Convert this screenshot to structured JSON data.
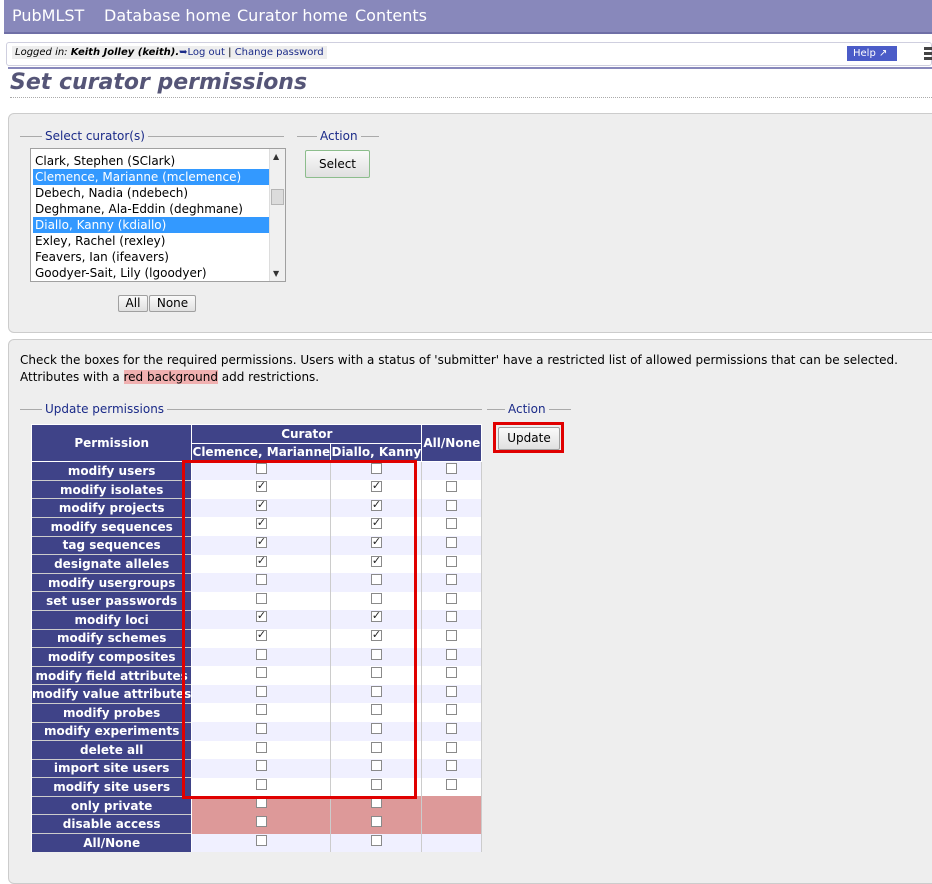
{
  "nav": {
    "items": [
      "PubMLST",
      "Database home",
      "Curator home",
      "Contents"
    ]
  },
  "login": {
    "prefix": "Logged in:",
    "user": "Keith Jolley (keith).",
    "logout": "Log out",
    "separator": "|",
    "change_password": "Change password"
  },
  "help": {
    "label": "Help",
    "icon": "external-link-icon"
  },
  "page_title": "Set curator permissions",
  "select_panel": {
    "legend_curators": "Select curator(s)",
    "legend_action": "Action",
    "select_button": "Select",
    "options": [
      {
        "label": "Clark, Stephen (SClark)",
        "selected": false
      },
      {
        "label": "Clemence, Marianne (mclemence)",
        "selected": true
      },
      {
        "label": "Debech, Nadia (ndebech)",
        "selected": false
      },
      {
        "label": "Deghmane, Ala-Eddin (deghmane)",
        "selected": false
      },
      {
        "label": "Diallo, Kanny (kdiallo)",
        "selected": true
      },
      {
        "label": "Exley, Rachel (rexley)",
        "selected": false
      },
      {
        "label": "Feavers, Ian (ifeavers)",
        "selected": false
      },
      {
        "label": "Goodyer-Sait, Lily (lgoodyer)",
        "selected": false
      }
    ],
    "all_button": "All",
    "none_button": "None"
  },
  "permissions_panel": {
    "intro_part1": "Check the boxes for the required permissions. Users with a status of 'submitter' have a restricted list of allowed permissions that can be selected. Attributes with a ",
    "intro_highlight": "red background",
    "intro_part2": " add restrictions.",
    "legend_update": "Update permissions",
    "legend_action": "Action",
    "update_button": "Update",
    "header_permission": "Permission",
    "header_curator": "Curator",
    "header_allnone": "All/None",
    "curators": [
      "Clemence, Marianne",
      "Diallo, Kanny"
    ],
    "rows": [
      {
        "name": "modify users",
        "c1": false,
        "c2": false,
        "allnone": true,
        "restricted": false
      },
      {
        "name": "modify isolates",
        "c1": true,
        "c2": true,
        "allnone": true,
        "restricted": false
      },
      {
        "name": "modify projects",
        "c1": true,
        "c2": true,
        "allnone": true,
        "restricted": false
      },
      {
        "name": "modify sequences",
        "c1": true,
        "c2": true,
        "allnone": true,
        "restricted": false
      },
      {
        "name": "tag sequences",
        "c1": true,
        "c2": true,
        "allnone": true,
        "restricted": false
      },
      {
        "name": "designate alleles",
        "c1": true,
        "c2": true,
        "allnone": true,
        "restricted": false
      },
      {
        "name": "modify usergroups",
        "c1": false,
        "c2": false,
        "allnone": true,
        "restricted": false
      },
      {
        "name": "set user passwords",
        "c1": false,
        "c2": false,
        "allnone": true,
        "restricted": false
      },
      {
        "name": "modify loci",
        "c1": true,
        "c2": true,
        "allnone": true,
        "restricted": false
      },
      {
        "name": "modify schemes",
        "c1": true,
        "c2": true,
        "allnone": true,
        "restricted": false
      },
      {
        "name": "modify composites",
        "c1": false,
        "c2": false,
        "allnone": true,
        "restricted": false
      },
      {
        "name": "modify field attributes",
        "c1": false,
        "c2": false,
        "allnone": true,
        "restricted": false
      },
      {
        "name": "modify value attributes",
        "c1": false,
        "c2": false,
        "allnone": true,
        "restricted": false
      },
      {
        "name": "modify probes",
        "c1": false,
        "c2": false,
        "allnone": true,
        "restricted": false
      },
      {
        "name": "modify experiments",
        "c1": false,
        "c2": false,
        "allnone": true,
        "restricted": false
      },
      {
        "name": "delete all",
        "c1": false,
        "c2": false,
        "allnone": true,
        "restricted": false
      },
      {
        "name": "import site users",
        "c1": false,
        "c2": false,
        "allnone": true,
        "restricted": false
      },
      {
        "name": "modify site users",
        "c1": false,
        "c2": false,
        "allnone": true,
        "restricted": false
      },
      {
        "name": "only private",
        "c1": false,
        "c2": false,
        "allnone": false,
        "restricted": true
      },
      {
        "name": "disable access",
        "c1": false,
        "c2": false,
        "allnone": false,
        "restricted": true
      },
      {
        "name": "All/None",
        "c1": false,
        "c2": false,
        "allnone": false,
        "restricted": false
      }
    ]
  },
  "colors": {
    "nav_bg": "#8888bb",
    "table_header": "#3f4388",
    "restricted_bg": "#dd9999",
    "selected_option": "#3399ff",
    "highlight_box": "#e00000"
  }
}
